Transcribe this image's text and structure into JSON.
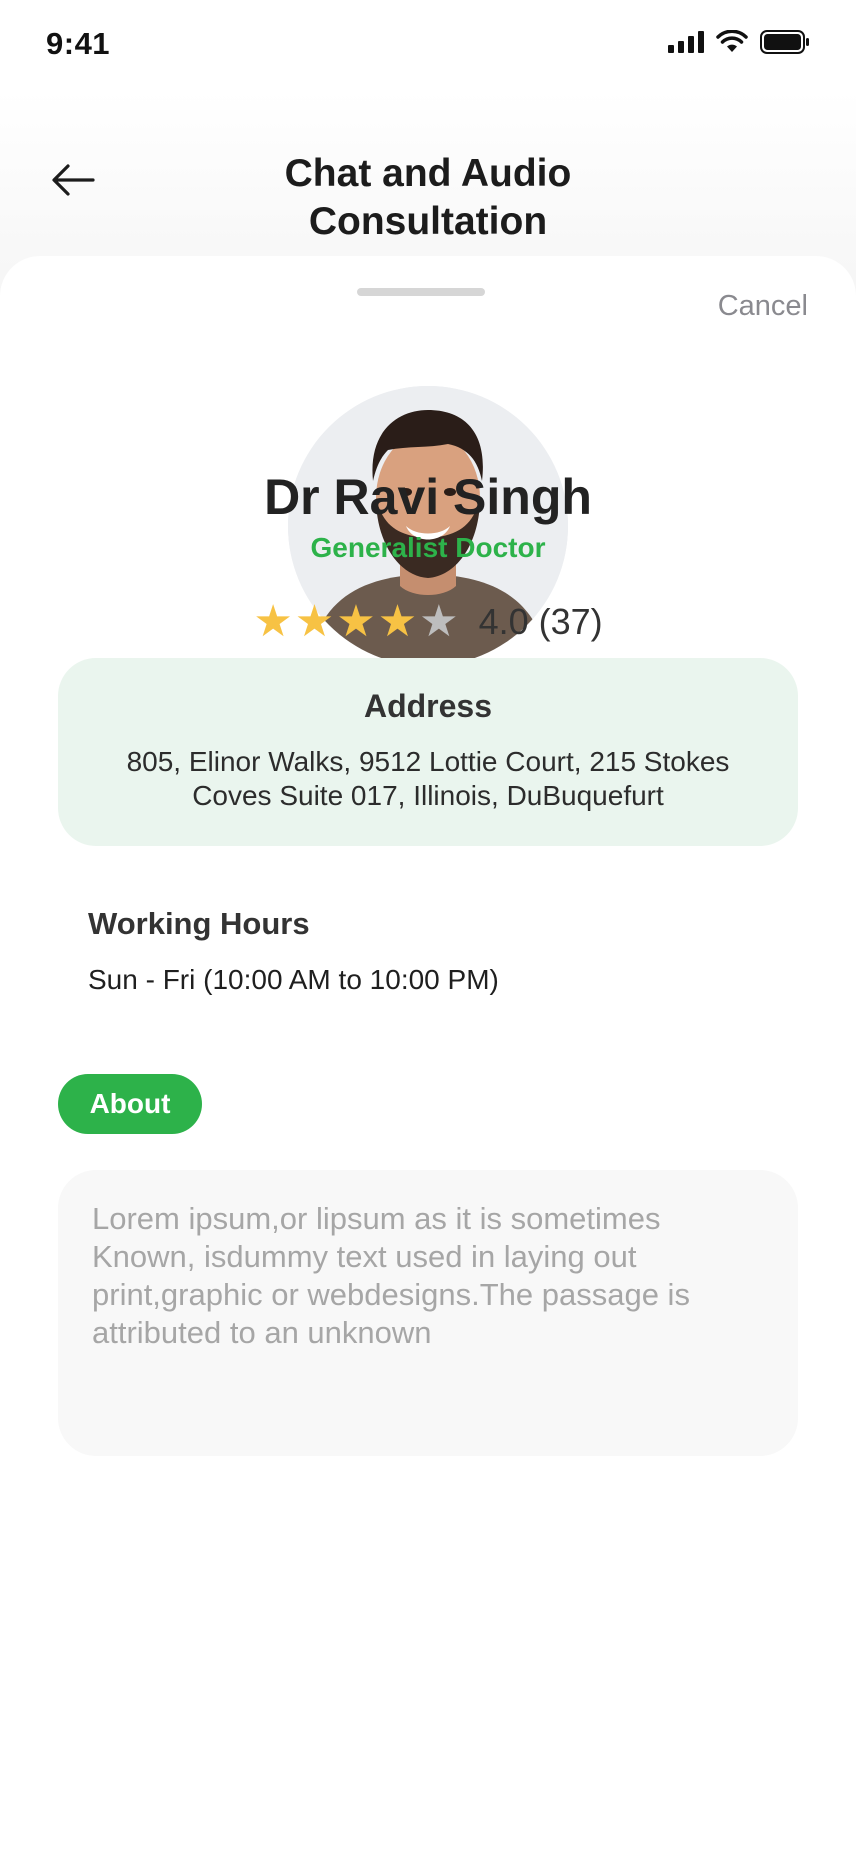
{
  "status_bar": {
    "time": "9:41"
  },
  "header": {
    "title_line1": "Chat and Audio",
    "title_line2": "Consultation"
  },
  "sheet": {
    "cancel_label": "Cancel"
  },
  "doctor": {
    "name": "Dr Ravi Singh",
    "specialty": "Generalist Doctor",
    "rating": 4.0,
    "rating_text": "4.0 (37)",
    "stars_filled": 4,
    "stars_total": 5
  },
  "address": {
    "title": "Address",
    "line1": "805, Elinor Walks, 9512 Lottie Court, 215 Stokes",
    "line2": "Coves Suite 017, Illinois, DuBuquefurt"
  },
  "working_hours": {
    "title": "Working Hours",
    "value": "Sun - Fri (10:00 AM to 10:00 PM)"
  },
  "about": {
    "button_label": "About",
    "text": "Lorem ipsum,or lipsum as it is sometimes Known, isdummy text used in laying out print,graphic or webdesigns.The passage is attributed to an unknown"
  },
  "colors": {
    "accent": "#2db24a",
    "star": "#f7c244",
    "address_bg": "#eaf5ee"
  },
  "icons": {
    "back": "arrow-left-icon",
    "signal": "signal-icon",
    "wifi": "wifi-icon",
    "battery": "battery-icon"
  }
}
